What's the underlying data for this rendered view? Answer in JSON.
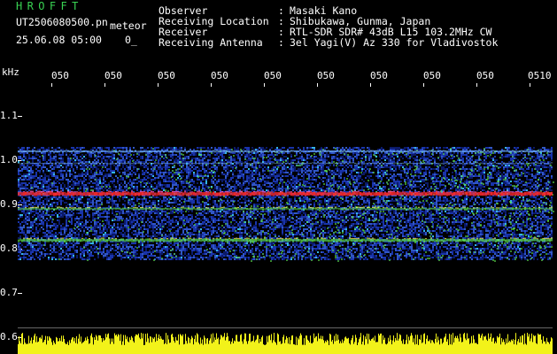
{
  "header": {
    "app_title": "HROFFT",
    "filename": "UT2506080500.pn",
    "mode": "meteor",
    "datetime": "25.06.08 05:00",
    "flag": "0_"
  },
  "station_info": [
    {
      "label": "Observer",
      "value": "Masaki Kano"
    },
    {
      "label": "Receiving Location",
      "value": "Shibukawa, Gunma, Japan"
    },
    {
      "label": "Receiver",
      "value": "RTL-SDR SDR# 43dB L15 103.2MHz CW"
    },
    {
      "label": "Receiving Antenna",
      "value": "3el Yagi(V) Az 330 for Vladivostok"
    }
  ],
  "separator": ":",
  "axis": {
    "y_unit": "kHz",
    "y_ticks": [
      "1.1",
      "1.0",
      "0.9",
      "0.8",
      "0.7",
      "0.6"
    ],
    "x_ticks": [
      "050",
      "050",
      "050",
      "050",
      "050",
      "050",
      "050",
      "050",
      "050",
      "0510"
    ]
  },
  "colors": {
    "background": "#000000",
    "title_green": "#39d353",
    "noise_blue": "#1d3cc8",
    "carrier_red": "#ff2a2a",
    "signal_green": "#5ee04a",
    "level_yellow": "#f2f21a"
  }
}
